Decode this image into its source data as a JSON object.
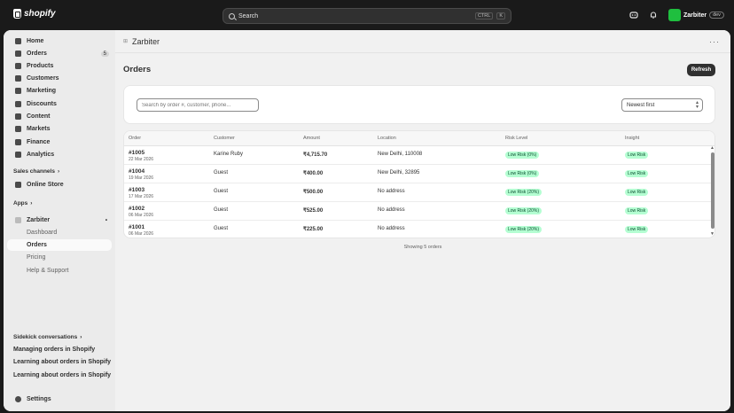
{
  "topbar": {
    "brand": "shopify",
    "search_placeholder": "Search",
    "shortcut_keys": [
      "CTRL",
      "K"
    ],
    "store_name": "Zarbiter",
    "store_tag": "dev"
  },
  "sidebar": {
    "nav": [
      {
        "label": "Home",
        "icon": "home-icon"
      },
      {
        "label": "Orders",
        "icon": "orders-icon",
        "badge": "5"
      },
      {
        "label": "Products",
        "icon": "tag-icon"
      },
      {
        "label": "Customers",
        "icon": "person-icon"
      },
      {
        "label": "Marketing",
        "icon": "target-icon"
      },
      {
        "label": "Discounts",
        "icon": "discount-icon"
      },
      {
        "label": "Content",
        "icon": "content-icon"
      },
      {
        "label": "Markets",
        "icon": "globe-icon"
      },
      {
        "label": "Finance",
        "icon": "bank-icon"
      },
      {
        "label": "Analytics",
        "icon": "chart-icon"
      }
    ],
    "sales_channels_label": "Sales channels",
    "online_store": "Online Store",
    "apps_label": "Apps",
    "app_name": "Zarbiter",
    "app_items": [
      "Dashboard",
      "Orders",
      "Pricing",
      "Help & Support"
    ],
    "sidekick_label": "Sidekick conversations",
    "conversations": [
      "Managing orders in Shopify",
      "Learning about orders in Shopify",
      "Learning about orders in Shopify"
    ],
    "settings": "Settings"
  },
  "main": {
    "app_title": "Zarbiter",
    "page_title": "Orders",
    "refresh_label": "Refresh",
    "search_placeholder": "Search by order #, customer, phone...",
    "sort_value": "Newest first",
    "columns": [
      "Order",
      "Customer",
      "Amount",
      "Location",
      "Risk Level",
      "Insight"
    ],
    "orders": [
      {
        "id": "#1005",
        "date": "22 Mar 2026",
        "customer": "Karine Ruby",
        "amount": "₹4,715.70",
        "location": "New Delhi, 110008",
        "risk": "Low Risk (0%)",
        "insight": "Low Risk"
      },
      {
        "id": "#1004",
        "date": "19 Mar 2026",
        "customer": "Guest",
        "amount": "₹400.00",
        "location": "New Delhi, 32895",
        "risk": "Low Risk (0%)",
        "insight": "Low Risk"
      },
      {
        "id": "#1003",
        "date": "17 Mar 2026",
        "customer": "Guest",
        "amount": "₹500.00",
        "location": "No address",
        "risk": "Low Risk (20%)",
        "insight": "Low Risk"
      },
      {
        "id": "#1002",
        "date": "06 Mar 2026",
        "customer": "Guest",
        "amount": "₹525.00",
        "location": "No address",
        "risk": "Low Risk (20%)",
        "insight": "Low Risk"
      },
      {
        "id": "#1001",
        "date": "06 Mar 2026",
        "customer": "Guest",
        "amount": "₹225.00",
        "location": "No address",
        "risk": "Low Risk (20%)",
        "insight": "Low Risk"
      }
    ],
    "footer": "Showing 5 orders"
  },
  "colors": {
    "accent_dark": "#303030",
    "risk_pill_bg": "#b4fed2",
    "risk_pill_text": "#0c5132",
    "avatar": "#1fbf3f"
  }
}
